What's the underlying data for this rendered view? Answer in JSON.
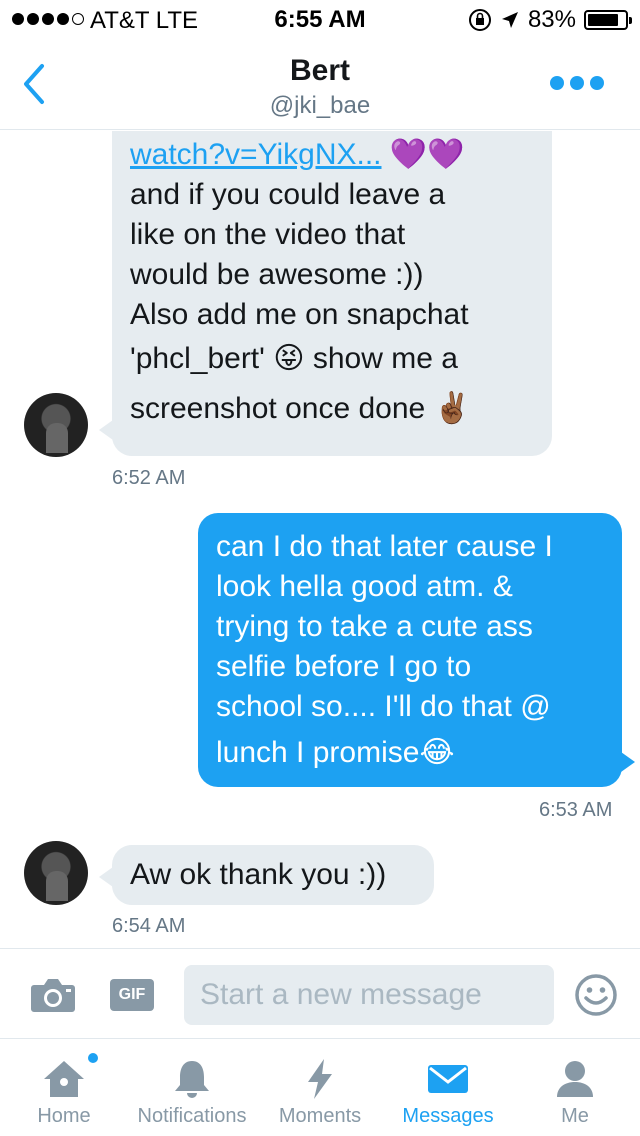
{
  "status_bar": {
    "carrier": "AT&T  LTE",
    "time": "6:55 AM",
    "battery": "83%",
    "battery_level": 0.83,
    "signal_bars": 4
  },
  "header": {
    "title": "Bert",
    "handle": "@jki_bae",
    "back_icon": "chevron-left-icon",
    "more_icon": "ellipsis-icon"
  },
  "messages": [
    {
      "direction": "incoming",
      "lines": [
        "watch?v=YikgNX...",
        "and if you could leave a",
        "like on the video that",
        "would be awesome :))",
        "Also add me on snapchat",
        "'phcl_bert'",
        "show me a",
        "screenshot once done"
      ],
      "emojis": [
        "💜💜",
        "😝",
        "✌🏾"
      ],
      "time": "6:52 AM"
    },
    {
      "direction": "outgoing",
      "lines": [
        "can I do that later cause I",
        "look hella good atm. &",
        "trying to take a cute ass",
        "selfie before I go to",
        "school so.... I'll do that @",
        "lunch I promise"
      ],
      "emojis": [
        "😂"
      ],
      "time": "6:53 AM"
    },
    {
      "direction": "incoming",
      "lines": [
        "Aw ok thank you :))"
      ],
      "time": "6:54 AM"
    }
  ],
  "composer": {
    "placeholder": "Start a new message",
    "gif_label": "GIF",
    "camera_icon": "camera-icon",
    "emoji_icon": "smiley-icon"
  },
  "tabs": [
    {
      "label": "Home",
      "icon": "home-icon",
      "active": false,
      "badge": true
    },
    {
      "label": "Notifications",
      "icon": "bell-icon",
      "active": false
    },
    {
      "label": "Moments",
      "icon": "lightning-icon",
      "active": false
    },
    {
      "label": "Messages",
      "icon": "envelope-icon",
      "active": true
    },
    {
      "label": "Me",
      "icon": "person-icon",
      "active": false
    }
  ],
  "colors": {
    "accent": "#1da1f2",
    "incoming_bubble": "#e6ecf0",
    "muted": "#657786",
    "inactive_icon": "#8899a6"
  }
}
